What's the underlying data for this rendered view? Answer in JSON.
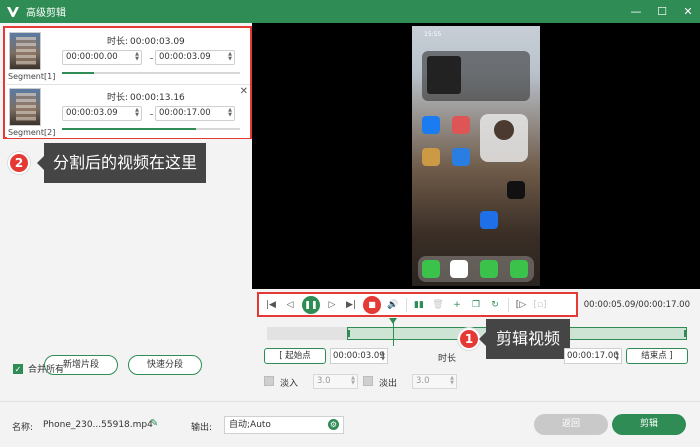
{
  "window": {
    "title": "高级剪辑",
    "buttons": {
      "minimize": "—",
      "maximize": "☐",
      "close": "✕"
    }
  },
  "segments": [
    {
      "name": "Segment[1]",
      "duration_label": "时长:",
      "duration": "00:00:03.09",
      "start": "00:00:00.00",
      "end": "00:00:03.09",
      "progress_fraction": 0.18
    },
    {
      "name": "Segment[2]",
      "duration_label": "时长:",
      "duration": "00:00:13.16",
      "start": "00:00:03.09",
      "end": "00:00:17.00",
      "progress_fraction": 0.75
    }
  ],
  "callouts": {
    "left": {
      "number": "2",
      "text": "分割后的视频在这里"
    },
    "right": {
      "number": "1",
      "text": "剪辑视频"
    }
  },
  "left_actions": {
    "add_segment": "新增片段",
    "quick_split": "快速分段",
    "merge_all": "合并所有",
    "merge_checked": true
  },
  "playback": {
    "time_readout": "00:00:05.09/00:00:17.00",
    "playhead_fraction": 0.3
  },
  "trim": {
    "start_button": "起始点",
    "start_value": "00:00:03.09",
    "duration_label": "时长",
    "end_value": "00:00:17.00",
    "end_button": "结束点",
    "selection_start_fraction": 0.19
  },
  "fade": {
    "fade_in_label": "淡入",
    "fade_in_value": "3.0",
    "fade_out_label": "淡出",
    "fade_out_value": "3.0"
  },
  "bottom": {
    "name_label": "名称:",
    "file_name": "Phone_230...55918.mp4",
    "output_label": "输出:",
    "output_value": "自动;Auto",
    "back_button": "返回",
    "edit_button": "剪辑"
  },
  "phone": {
    "status_time": "15:55"
  },
  "colors": {
    "accent": "#2f8c55",
    "highlight": "#e53935",
    "callout_bg": "#454545"
  }
}
